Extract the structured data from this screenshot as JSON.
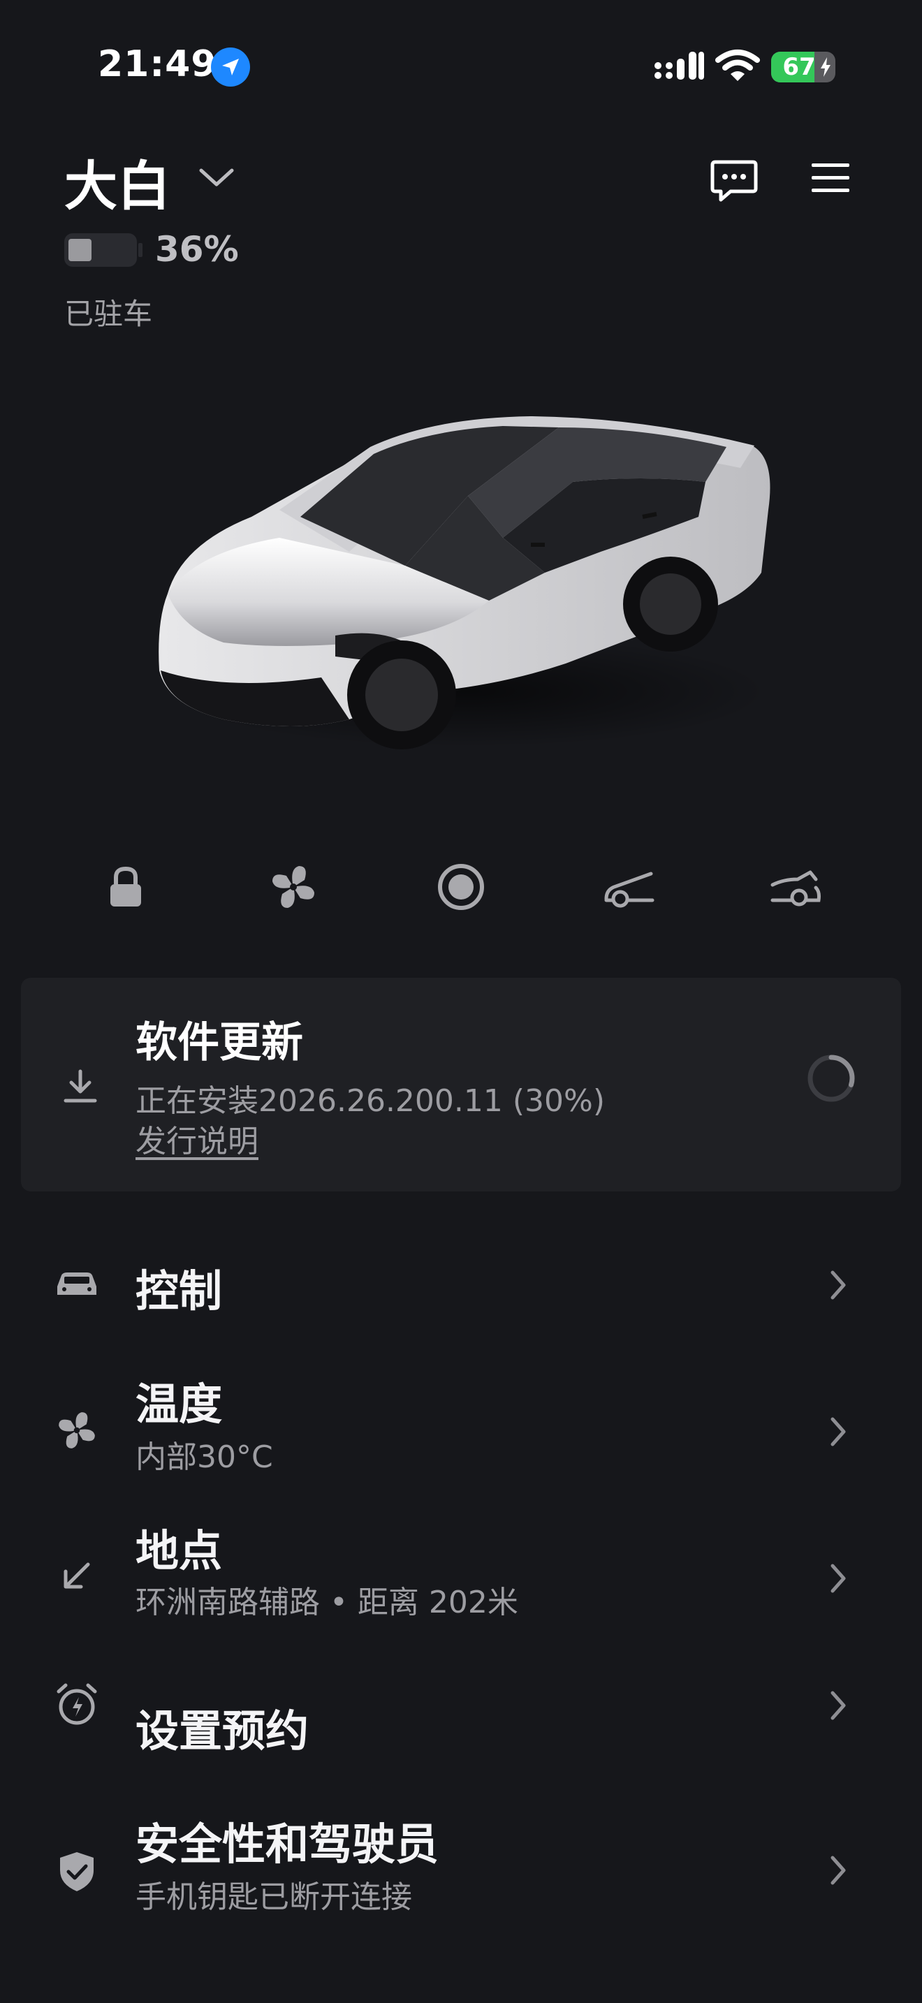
{
  "status_bar": {
    "time": "21:49",
    "battery_percent": "67",
    "battery_level": 0.67
  },
  "header": {
    "car_name": "大白"
  },
  "vehicle": {
    "battery_percent": "36%",
    "battery_level": 0.36,
    "state": "已驻车"
  },
  "quick_controls": [
    "lock-icon",
    "fan-icon",
    "record-icon",
    "frunk-icon",
    "trunk-icon"
  ],
  "software_update": {
    "title": "软件更新",
    "status": "正在安装2026.26.200.11 (30%)",
    "link": "发行说明",
    "progress": 0.3
  },
  "menu": [
    {
      "title": "控制",
      "subtitle": "",
      "icon": "car-icon"
    },
    {
      "title": "温度",
      "subtitle": "内部30°C",
      "icon": "fan-icon"
    },
    {
      "title": "地点",
      "subtitle": "环洲南路辅路 • 距离 202米",
      "icon": "location-arrow-icon"
    },
    {
      "title": "设置预约",
      "subtitle": "",
      "icon": "alarm-clock-icon"
    },
    {
      "title": "安全性和驾驶员",
      "subtitle": "手机钥匙已断开连接",
      "icon": "shield-check-icon"
    }
  ],
  "colors": {
    "background": "#16171b",
    "card": "#1f2024",
    "accent_location": "#1e88ff",
    "battery_green": "#34c759"
  }
}
